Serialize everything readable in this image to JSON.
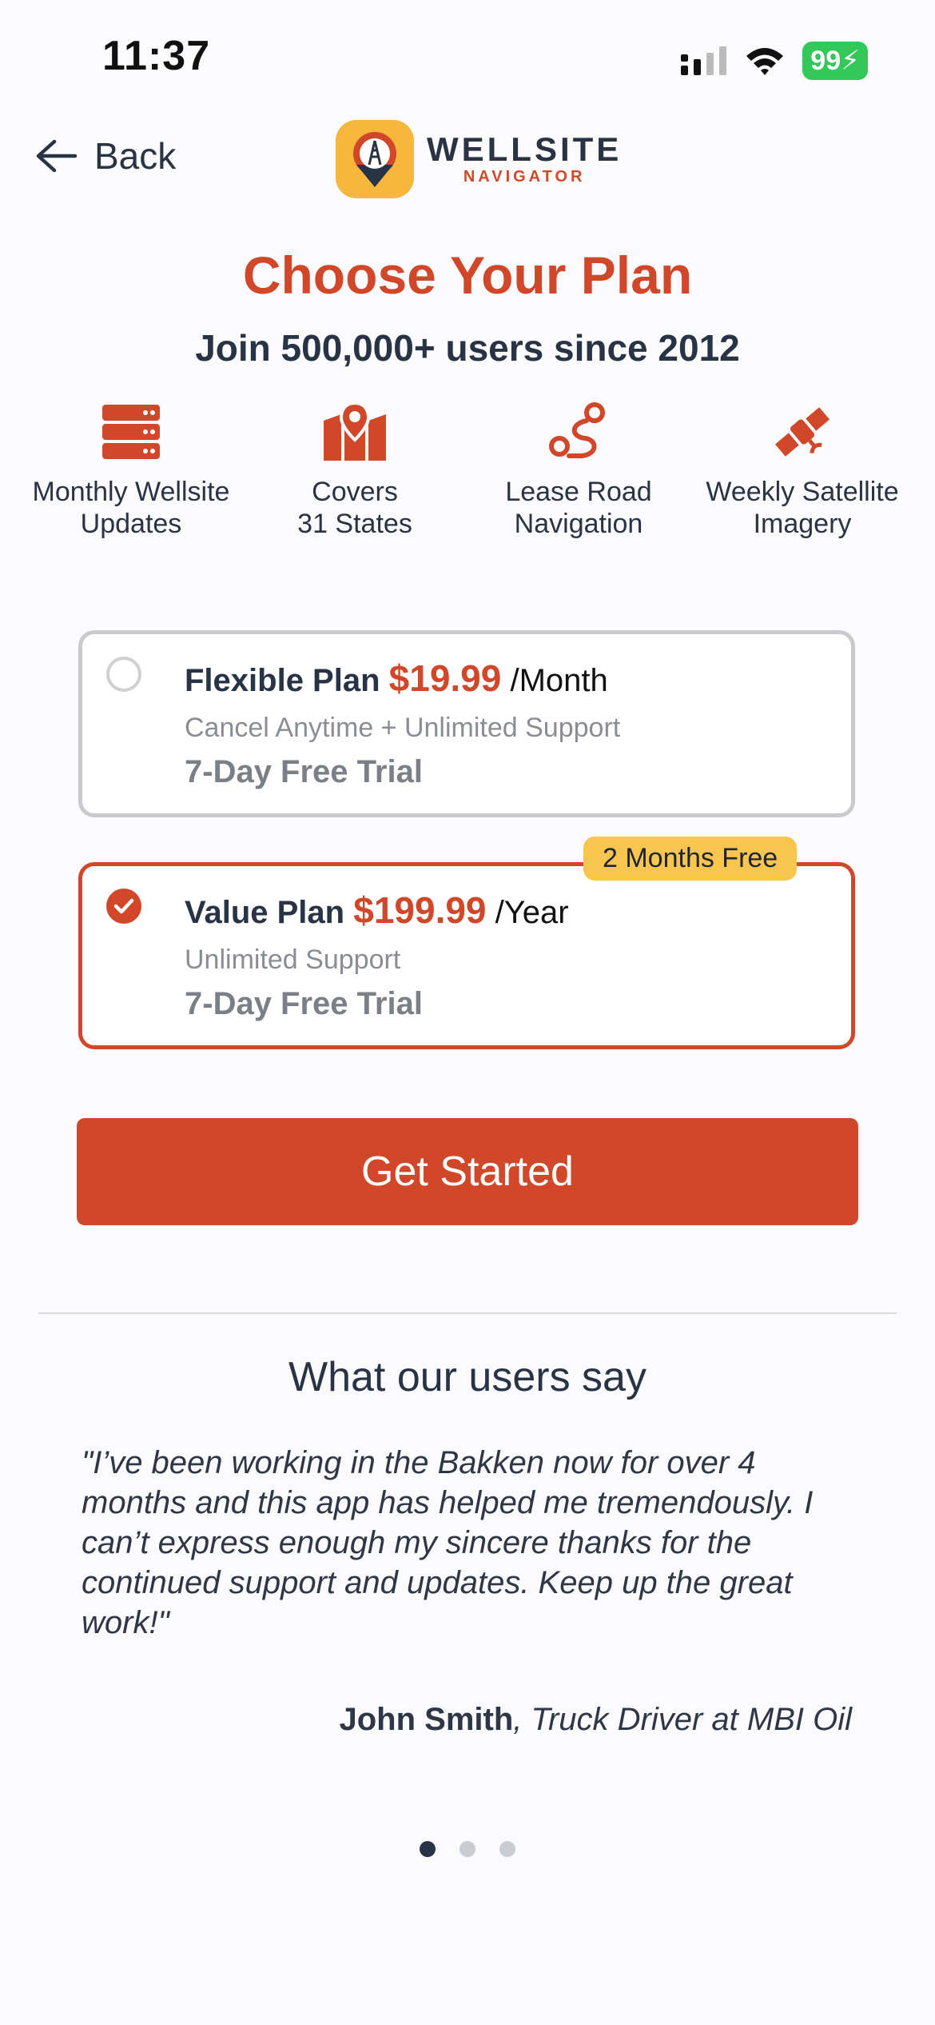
{
  "status_bar": {
    "time": "11:37",
    "battery": "99"
  },
  "header": {
    "back_label": "Back",
    "logo_line1": "WELLSITE",
    "logo_line2": "NAVIGATOR"
  },
  "title": "Choose Your Plan",
  "subtitle": "Join 500,000+ users since 2012",
  "features": [
    {
      "icon": "server-icon",
      "label_line1": "Monthly Wellsite",
      "label_line2": "Updates"
    },
    {
      "icon": "map-pin-icon",
      "label_line1": "Covers",
      "label_line2": "31 States"
    },
    {
      "icon": "route-icon",
      "label_line1": "Lease Road",
      "label_line2": "Navigation"
    },
    {
      "icon": "satellite-icon",
      "label_line1": "Weekly Satellite",
      "label_line2": "Imagery"
    }
  ],
  "plans": [
    {
      "name": "Flexible Plan",
      "price": "$19.99",
      "period": "/Month",
      "detail": "Cancel Anytime + Unlimited Support",
      "trial": "7-Day Free Trial",
      "selected": false
    },
    {
      "name": "Value Plan",
      "price": "$199.99",
      "period": "/Year",
      "detail": "Unlimited Support",
      "trial": "7-Day Free Trial",
      "badge": "2 Months Free",
      "selected": true
    }
  ],
  "cta_label": "Get Started",
  "testimonials": {
    "title": "What our users say",
    "quote": "\"I’ve been working in the Bakken now for over 4 months and this app has helped me tremendously. I can’t express enough my sincere thanks for the continued support and updates. Keep up the great work!\"",
    "author_name": "John Smith",
    "author_role": ", Truck Driver at MBI Oil",
    "pages": 3,
    "active_page": 1
  },
  "colors": {
    "accent": "#d0472a",
    "badge": "#f8c64f",
    "text": "#283345"
  }
}
